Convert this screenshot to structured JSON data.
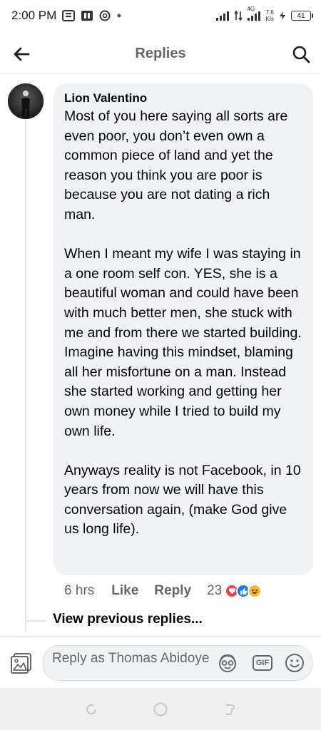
{
  "status_bar": {
    "time": "2:00 PM",
    "network": "4G",
    "speed_value": "7.6",
    "speed_unit": "K/s",
    "battery": "41"
  },
  "header": {
    "title": "Replies"
  },
  "comment": {
    "author": "Lion Valentino",
    "paragraphs": [
      "Most of you here saying all sorts are even poor, you don’t even own a common piece of land and yet the reason you think you are poor is because you are not dating a rich man.",
      "When I meant my wife I was staying in a one room self con. YES, she is a beautiful woman and could have been with much better men, she stuck with me and from there we started building. Imagine having this mindset, blaming all her misfortune on a man. Instead she started working and getting her own money while I tried to build my own life.",
      "Anyways reality is not Facebook, in 10 years from now we will have this conversation again, (make God give us long life)."
    ],
    "time": "6 hrs",
    "like_label": "Like",
    "reply_label": "Reply",
    "reaction_count": "23",
    "reactions": [
      "love-icon",
      "like-icon",
      "haha-icon"
    ]
  },
  "view_previous": "View previous replies...",
  "composer": {
    "placeholder": "Reply as Thomas Abidoye",
    "gif_label": "GIF"
  },
  "colors": {
    "bubble": "#f0f2f5",
    "secondary_text": "#65676b",
    "love": "#f33e58",
    "like": "#1877f2",
    "haha": "#f7b928"
  }
}
